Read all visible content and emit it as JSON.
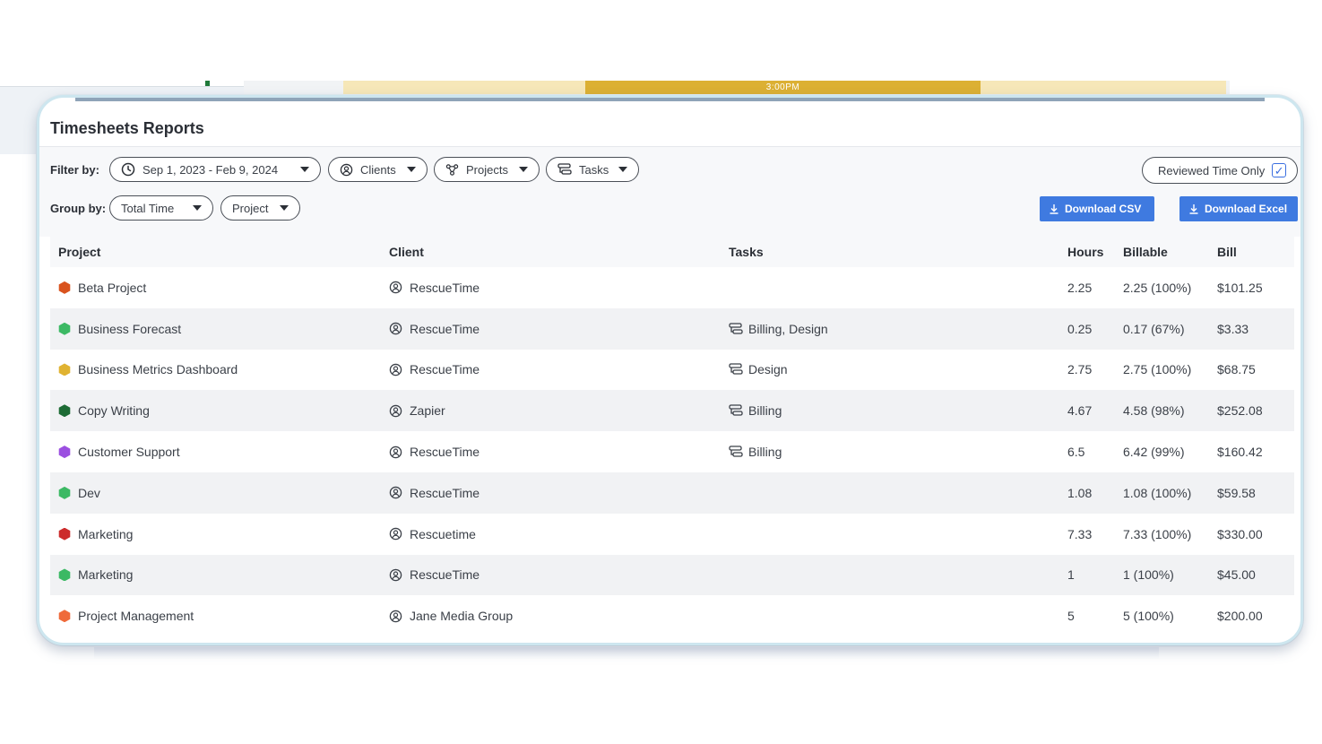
{
  "background": {
    "timeline_label": "3:00PM"
  },
  "report": {
    "title": "Timesheets Reports",
    "filter_label": "Filter by:",
    "group_label": "Group by:",
    "filters": {
      "date_range": "Sep 1, 2023 - Feb 9, 2024",
      "clients": "Clients",
      "projects": "Projects",
      "tasks": "Tasks"
    },
    "group_by": {
      "primary": "Total Time",
      "secondary": "Project"
    },
    "reviewed_toggle": {
      "label": "Reviewed Time Only",
      "checked": true
    },
    "download_csv": "Download CSV",
    "download_excel": "Download Excel",
    "columns": {
      "project": "Project",
      "client": "Client",
      "tasks": "Tasks",
      "hours": "Hours",
      "billable": "Billable",
      "bill": "Bill"
    },
    "rows": [
      {
        "project": "Beta Project",
        "color": "#d9531e",
        "client": "RescueTime",
        "tasks": "",
        "hours": "2.25",
        "billable": "2.25 (100%)",
        "bill": "$101.25"
      },
      {
        "project": "Business Forecast",
        "color": "#3cb964",
        "client": "RescueTime",
        "tasks": "Billing, Design",
        "hours": "0.25",
        "billable": "0.17 (67%)",
        "bill": "$3.33"
      },
      {
        "project": "Business Metrics Dashboard",
        "color": "#e0b332",
        "client": "RescueTime",
        "tasks": "Design",
        "hours": "2.75",
        "billable": "2.75 (100%)",
        "bill": "$68.75"
      },
      {
        "project": "Copy Writing",
        "color": "#1d6b35",
        "client": "Zapier",
        "tasks": "Billing",
        "hours": "4.67",
        "billable": "4.58 (98%)",
        "bill": "$252.08"
      },
      {
        "project": "Customer Support",
        "color": "#9b4fe0",
        "client": "RescueTime",
        "tasks": "Billing",
        "hours": "6.5",
        "billable": "6.42 (99%)",
        "bill": "$160.42"
      },
      {
        "project": "Dev",
        "color": "#3cb964",
        "client": "RescueTime",
        "tasks": "",
        "hours": "1.08",
        "billable": "1.08 (100%)",
        "bill": "$59.58"
      },
      {
        "project": "Marketing",
        "color": "#cc2b2b",
        "client": "Rescuetime",
        "tasks": "",
        "hours": "7.33",
        "billable": "7.33 (100%)",
        "bill": "$330.00"
      },
      {
        "project": "Marketing",
        "color": "#3cb964",
        "client": "RescueTime",
        "tasks": "",
        "hours": "1",
        "billable": "1 (100%)",
        "bill": "$45.00"
      },
      {
        "project": "Project Management",
        "color": "#ef6a3a",
        "client": "Jane Media Group",
        "tasks": "",
        "hours": "5",
        "billable": "5 (100%)",
        "bill": "$200.00"
      }
    ]
  }
}
